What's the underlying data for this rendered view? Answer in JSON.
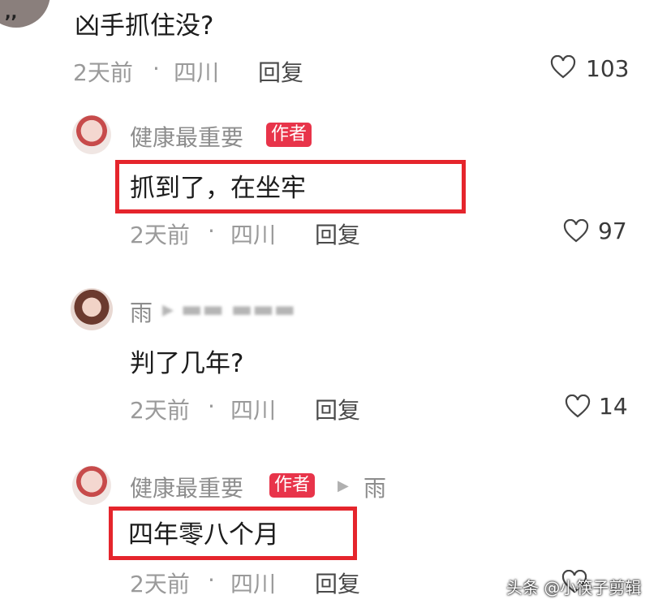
{
  "comments": [
    {
      "text": "凶手抓住没?",
      "time": "2天前",
      "sep": "·",
      "location": "四川",
      "reply": "回复",
      "likes": "103"
    },
    {
      "username": "健康最重要",
      "badge": "作者",
      "text": "抓到了，在坐牢",
      "time": "2天前",
      "sep": "·",
      "location": "四川",
      "reply": "回复",
      "likes": "97"
    },
    {
      "username": "雨",
      "text": "判了几年?",
      "time": "2天前",
      "sep": "·",
      "location": "四川",
      "reply": "回复",
      "likes": "14"
    },
    {
      "username": "健康最重要",
      "badge": "作者",
      "reply_to": "雨",
      "text": "四年零八个月",
      "time": "2天前",
      "sep": "·",
      "location": "四川",
      "reply": "回复"
    }
  ],
  "watermark": "头条 @小筷子剪辑",
  "colors": {
    "badge": "#e8344a",
    "highlight_box": "#e5252c"
  }
}
